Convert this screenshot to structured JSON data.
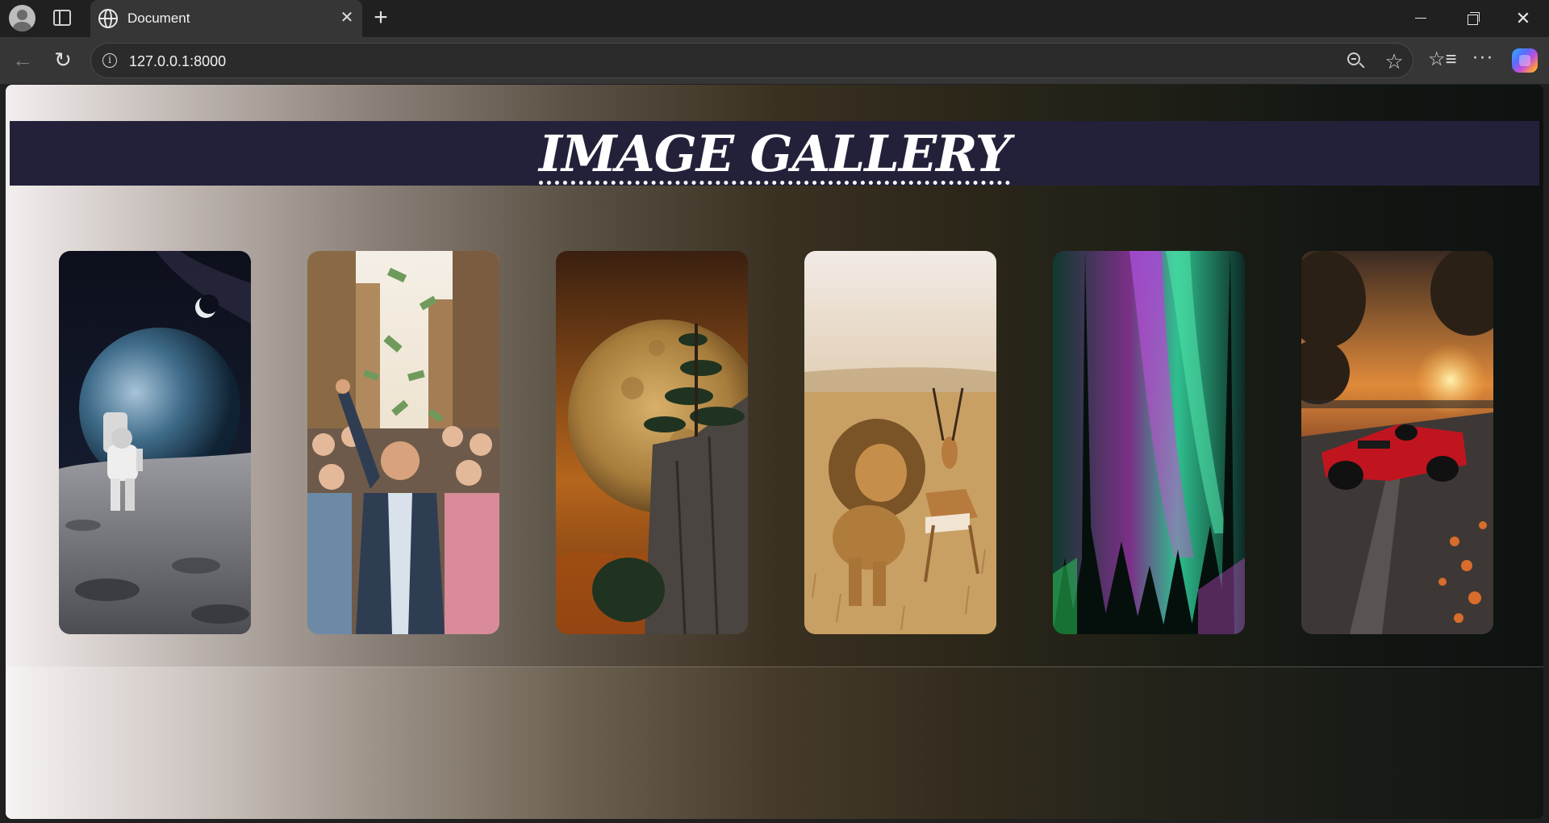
{
  "browser": {
    "tab_title": "Document",
    "address_url": "127.0.0.1:8000",
    "icons": [
      "profile-avatar",
      "sidebar-toggle",
      "globe",
      "close",
      "plus",
      "back-arrow",
      "reload",
      "info",
      "zoom-out",
      "star",
      "favorites",
      "more",
      "copilot"
    ]
  },
  "page": {
    "heading": "IMAGE GALLERY",
    "header_color": "#23213a",
    "gallery": [
      {
        "subject": "astronaut-on-moon"
      },
      {
        "subject": "money-crowd"
      },
      {
        "subject": "golden-moon-cliff"
      },
      {
        "subject": "lion-gazelle"
      },
      {
        "subject": "aurora-forest"
      },
      {
        "subject": "race-car-sunset"
      }
    ]
  }
}
